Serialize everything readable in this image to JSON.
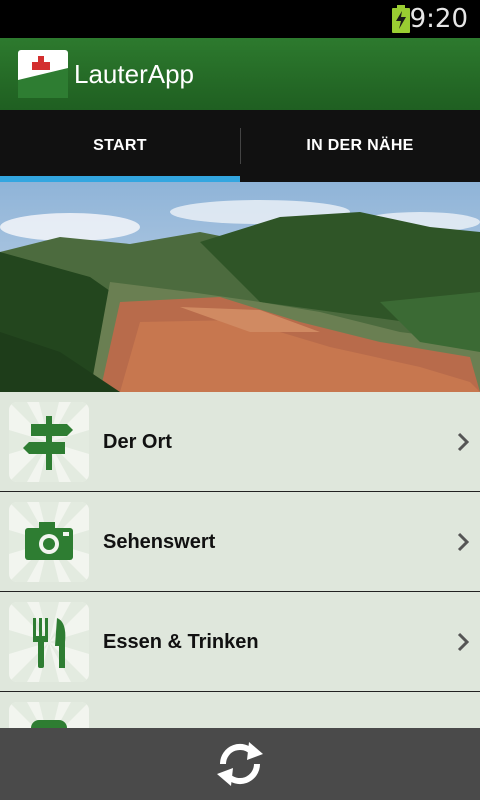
{
  "status_bar": {
    "time": "9:20",
    "battery_icon": "battery-charging-icon"
  },
  "action_bar": {
    "title": "LauterApp",
    "logo_icon": "app-logo-icon"
  },
  "tabs": [
    {
      "label": "START",
      "selected": true
    },
    {
      "label": "IN DER NÄHE",
      "selected": false
    }
  ],
  "colors": {
    "accent": "#33a6e0",
    "brand_green": "#2d7a2e",
    "icon_green": "#2e7d32"
  },
  "list": {
    "items": [
      {
        "label": "Der Ort",
        "icon": "signpost-icon"
      },
      {
        "label": "Sehenswert",
        "icon": "camera-icon"
      },
      {
        "label": "Essen & Trinken",
        "icon": "fork-knife-icon"
      },
      {
        "label": "",
        "icon": "partial-icon"
      }
    ]
  },
  "bottom_bar": {
    "refresh_icon": "refresh-icon"
  }
}
